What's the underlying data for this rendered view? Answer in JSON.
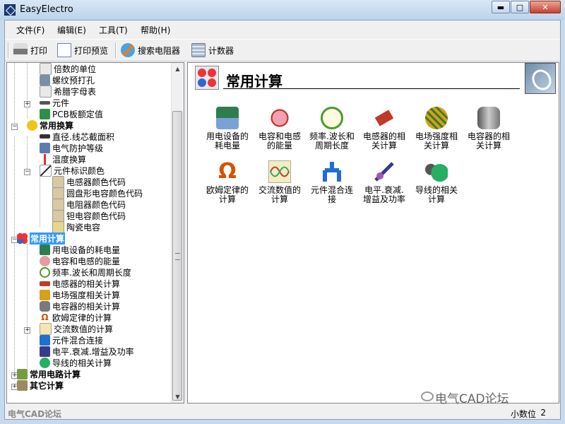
{
  "window": {
    "title": "EasyElectro",
    "minimize": "▬",
    "maximize": "□",
    "close": "✕"
  },
  "menu": [
    {
      "label": "文件(F)"
    },
    {
      "label": "编辑(E)"
    },
    {
      "label": "工具(T)"
    },
    {
      "label": "帮助(H)"
    }
  ],
  "toolbar": {
    "print": "打印",
    "preview": "打印预览",
    "resistor": "搜索电阻器",
    "calculator": "计数器"
  },
  "tree": [
    {
      "label": "倍数的单位",
      "bold": false,
      "icon": "document-icon"
    },
    {
      "label": "螺纹预打孔",
      "bold": false,
      "icon": "screw-icon"
    },
    {
      "label": "希腊字母表",
      "bold": false,
      "icon": "document-icon"
    },
    {
      "label": "元件",
      "bold": false,
      "icon": "component-icon"
    },
    {
      "label": "PCB板额定值",
      "bold": false,
      "icon": "pcb-icon"
    },
    {
      "label": "常用换算",
      "bold": true,
      "icon": "convert-icon"
    },
    {
      "label": "直径.线芯截面积",
      "bold": false,
      "icon": "wire-icon"
    },
    {
      "label": "电气防护等级",
      "bold": false,
      "icon": "protection-icon"
    },
    {
      "label": "温度换算",
      "bold": false,
      "icon": "thermometer-icon"
    },
    {
      "label": "元件标识颜色",
      "bold": false,
      "icon": "color-code-icon"
    },
    {
      "label": "电感器颜色代码",
      "bold": false,
      "icon": "inductor-icon"
    },
    {
      "label": "圆盘形电容颜色代码",
      "bold": false,
      "icon": "disc-capacitor-icon"
    },
    {
      "label": "电阻器颜色代码",
      "bold": false,
      "icon": "resistor-icon"
    },
    {
      "label": "钽电容颜色代码",
      "bold": false,
      "icon": "tantalum-icon"
    },
    {
      "label": "陶瓷电容",
      "bold": false,
      "icon": "ceramic-icon"
    },
    {
      "label": "常用计算",
      "bold": true,
      "icon": "calc-icon",
      "selected": true
    },
    {
      "label": "用电设备的耗电量",
      "bold": false,
      "icon": "power-icon"
    },
    {
      "label": "电容和电感的能量",
      "bold": false,
      "icon": "energy-icon"
    },
    {
      "label": "频率.波长和周期长度",
      "bold": false,
      "icon": "clock-icon"
    },
    {
      "label": "电感器的相关计算",
      "bold": false,
      "icon": "inductor-icon"
    },
    {
      "label": "电场强度相关计算",
      "bold": false,
      "icon": "field-icon"
    },
    {
      "label": "电容器的相关计算",
      "bold": false,
      "icon": "capacitor-icon"
    },
    {
      "label": "欧姆定律的计算",
      "bold": false,
      "icon": "ohm-icon"
    },
    {
      "label": "交流数值的计算",
      "bold": false,
      "icon": "ac-icon"
    },
    {
      "label": "元件混合连接",
      "bold": false,
      "icon": "mixed-icon"
    },
    {
      "label": "电平.衰减.增益及功率",
      "bold": false,
      "icon": "level-icon"
    },
    {
      "label": "导线的相关计算",
      "bold": false,
      "icon": "conductor-icon"
    },
    {
      "label": "常用电路计算",
      "bold": true,
      "icon": "circuit-icon"
    },
    {
      "label": "其它计算",
      "bold": true,
      "icon": "other-icon"
    }
  ],
  "panel": {
    "title": "常用计算",
    "items": [
      {
        "line1": "用电设备的",
        "line2": "耗电量",
        "icon": "power-icon",
        "color": "#2e7d4f"
      },
      {
        "line1": "电容和电感",
        "line2": "的能量",
        "icon": "energy-icon",
        "color": "#c0392b"
      },
      {
        "line1": "频率.波长和",
        "line2": "周期长度",
        "icon": "clock-icon",
        "color": "#4a9a2a"
      },
      {
        "line1": "电感器的相",
        "line2": "关计算",
        "icon": "inductor-icon",
        "color": "#c0392b"
      },
      {
        "line1": "电场强度相",
        "line2": "关计算",
        "icon": "field-icon",
        "color": "#d6a019"
      },
      {
        "line1": "电容器的相",
        "line2": "关计算",
        "icon": "capacitor-icon",
        "color": "#7a7a7a"
      },
      {
        "line1": "欧姆定律的",
        "line2": "计算",
        "icon": "ohm-icon",
        "color": "#d35400"
      },
      {
        "line1": "交流数值的",
        "line2": "计算",
        "icon": "ac-icon",
        "color": "#c0392b"
      },
      {
        "line1": "元件混合连",
        "line2": "接",
        "icon": "mixed-icon",
        "color": "#1f6fd1"
      },
      {
        "line1": "电平.衰减.",
        "line2": "增益及功率",
        "icon": "level-icon",
        "color": "#3a3a8a"
      },
      {
        "line1": "导线的相关",
        "line2": "计算",
        "icon": "conductor-icon",
        "color": "#27ae60"
      }
    ]
  },
  "status": {
    "left": "电气CAD论坛",
    "decimal_label": "小数位",
    "decimal_value": "2"
  },
  "watermark": "电气CAD论坛"
}
